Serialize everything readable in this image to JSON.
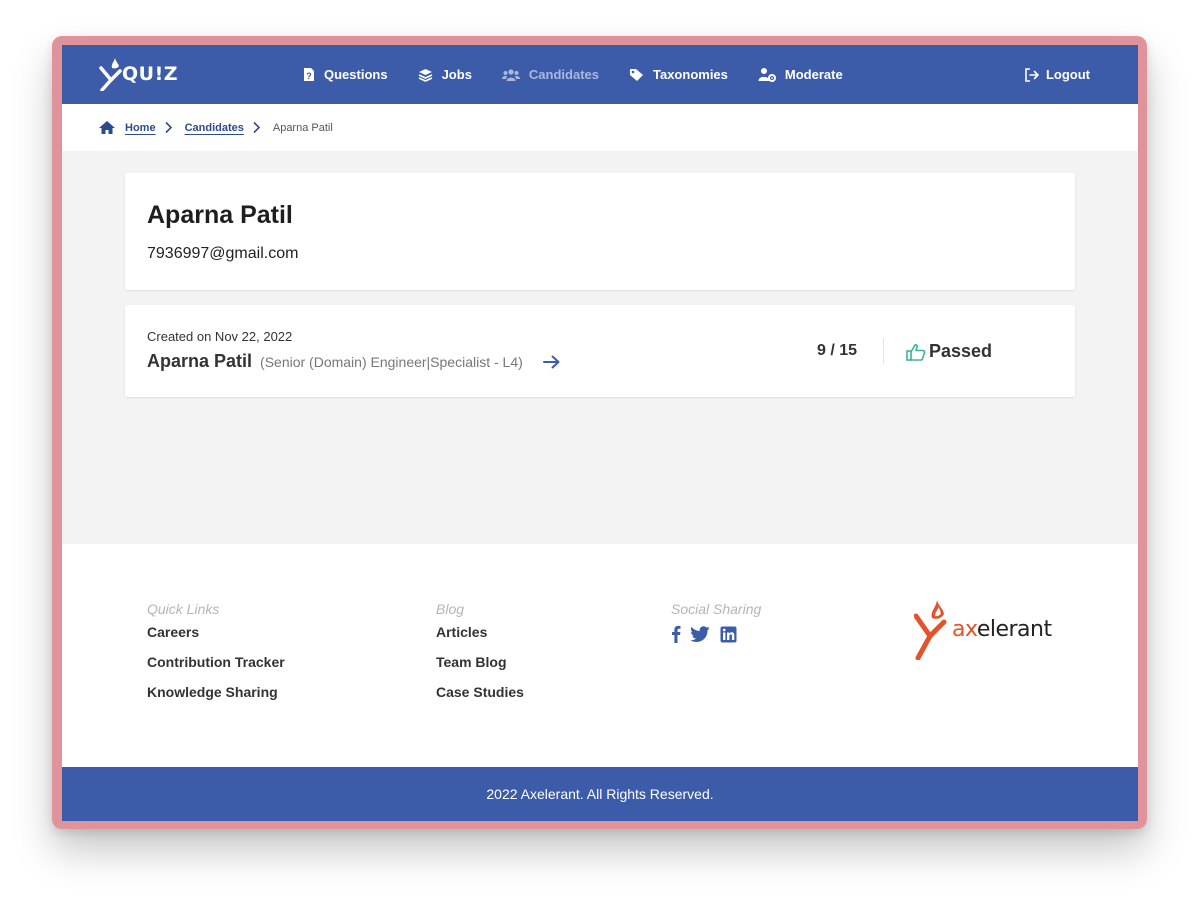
{
  "header": {
    "logo_text": "QU!Z",
    "nav": [
      {
        "label": "Questions"
      },
      {
        "label": "Jobs"
      },
      {
        "label": "Candidates"
      },
      {
        "label": "Taxonomies"
      },
      {
        "label": "Moderate"
      }
    ],
    "logout_label": "Logout"
  },
  "breadcrumb": {
    "home": "Home",
    "candidates": "Candidates",
    "current": "Aparna Patil"
  },
  "profile": {
    "name": "Aparna Patil",
    "email": "7936997@gmail.com"
  },
  "result": {
    "created": "Created on Nov 22, 2022",
    "candidate_name": "Aparna Patil",
    "role": "(Senior (Domain) Engineer|Specialist - L4)",
    "score": "9 / 15",
    "status": "Passed"
  },
  "footer": {
    "quick_links": {
      "heading": "Quick Links",
      "items": [
        "Careers",
        "Contribution Tracker",
        "Knowledge Sharing"
      ]
    },
    "blog": {
      "heading": "Blog",
      "items": [
        "Articles",
        "Team Blog",
        "Case Studies"
      ]
    },
    "social": {
      "heading": "Social Sharing",
      "icons": [
        "facebook-icon",
        "twitter-icon",
        "linkedin-icon"
      ]
    },
    "brand": {
      "prefix": "ax",
      "rest": "elerant"
    },
    "copyright": "2022 Axelerant. All Rights Reserved."
  },
  "colors": {
    "primary": "#3c5caa",
    "frame": "#e0939b",
    "brand_orange": "#e2532b",
    "pass_green": "#3bb39a",
    "link_blue": "#2e4a8e"
  }
}
